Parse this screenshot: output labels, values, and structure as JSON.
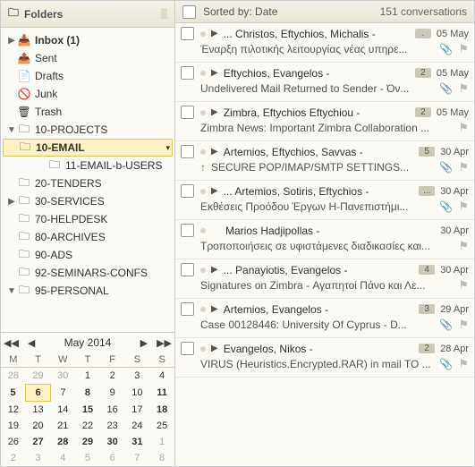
{
  "folders_pane": {
    "title": "Folders",
    "items": [
      {
        "twisty": "▶",
        "depth": 0,
        "icon": "inbox",
        "label": "Inbox (1)",
        "bold": true
      },
      {
        "twisty": "",
        "depth": 0,
        "icon": "sent",
        "label": "Sent"
      },
      {
        "twisty": "",
        "depth": 0,
        "icon": "drafts",
        "label": "Drafts"
      },
      {
        "twisty": "",
        "depth": 0,
        "icon": "junk",
        "label": "Junk"
      },
      {
        "twisty": "",
        "depth": 0,
        "icon": "trash",
        "label": "Trash"
      },
      {
        "twisty": "▼",
        "depth": 0,
        "icon": "folder",
        "label": "10-PROJECTS"
      },
      {
        "twisty": "",
        "depth": 1,
        "icon": "folder",
        "label": "10-EMAIL",
        "selected": true,
        "menu": true
      },
      {
        "twisty": "",
        "depth": 2,
        "icon": "folder",
        "label": "11-EMAIL-b-USERS"
      },
      {
        "twisty": "",
        "depth": 0,
        "icon": "folder",
        "label": "20-TENDERS"
      },
      {
        "twisty": "▶",
        "depth": 0,
        "icon": "folder",
        "label": "30-SERVICES"
      },
      {
        "twisty": "",
        "depth": 0,
        "icon": "folder",
        "label": "70-HELPDESK"
      },
      {
        "twisty": "",
        "depth": 0,
        "icon": "folder",
        "label": "80-ARCHIVES"
      },
      {
        "twisty": "",
        "depth": 0,
        "icon": "folder",
        "label": "90-ADS"
      },
      {
        "twisty": "",
        "depth": 0,
        "icon": "folder",
        "label": "92-SEMINARS-CONFS"
      },
      {
        "twisty": "▼",
        "depth": 0,
        "icon": "folder",
        "label": "95-PERSONAL"
      }
    ]
  },
  "calendar": {
    "title": "May 2014",
    "dow": [
      "M",
      "T",
      "W",
      "T",
      "F",
      "S",
      "S"
    ],
    "weeks": [
      [
        {
          "d": 28,
          "o": true
        },
        {
          "d": 29,
          "o": true
        },
        {
          "d": 30,
          "o": true
        },
        {
          "d": 1
        },
        {
          "d": 2
        },
        {
          "d": 3
        },
        {
          "d": 4
        }
      ],
      [
        {
          "d": 5,
          "b": true
        },
        {
          "d": 6,
          "t": true
        },
        {
          "d": 7
        },
        {
          "d": 8,
          "b": true
        },
        {
          "d": 9
        },
        {
          "d": 10
        },
        {
          "d": 11,
          "b": true
        }
      ],
      [
        {
          "d": 12
        },
        {
          "d": 13
        },
        {
          "d": 14
        },
        {
          "d": 15,
          "b": true
        },
        {
          "d": 16
        },
        {
          "d": 17
        },
        {
          "d": 18,
          "b": true
        }
      ],
      [
        {
          "d": 19
        },
        {
          "d": 20
        },
        {
          "d": 21
        },
        {
          "d": 22
        },
        {
          "d": 23
        },
        {
          "d": 24
        },
        {
          "d": 25
        }
      ],
      [
        {
          "d": 26
        },
        {
          "d": 27,
          "b": true
        },
        {
          "d": 28,
          "b": true
        },
        {
          "d": 29,
          "b": true
        },
        {
          "d": 30,
          "b": true
        },
        {
          "d": 31,
          "b": true
        },
        {
          "d": 1,
          "o": true
        }
      ],
      [
        {
          "d": 2,
          "o": true
        },
        {
          "d": 3,
          "o": true
        },
        {
          "d": 4,
          "o": true
        },
        {
          "d": 5,
          "o": true
        },
        {
          "d": 6,
          "o": true
        },
        {
          "d": 7,
          "o": true
        },
        {
          "d": 8,
          "o": true
        }
      ]
    ]
  },
  "list_header": {
    "sorted_label": "Sorted by: Date",
    "count_label": "151 conversations"
  },
  "conversations": [
    {
      "expand": "▶",
      "ell": true,
      "from": "Christos, Eftychios, Michalis",
      "badge": ".",
      "date": "05 May",
      "subject": "Έναρξη πιλοτικής λειτουργίας νέας υπηρε...",
      "attach": true
    },
    {
      "expand": "▶",
      "from": "Eftychios, Evangelos",
      "badge": "2",
      "date": "05 May",
      "subject": "Undelivered Mail Returned to Sender - Όν...",
      "attach": true
    },
    {
      "expand": "▶",
      "from": "Zimbra, Eftychios Eftychiou",
      "badge": "2",
      "date": "05 May",
      "subject": "Zimbra News: Important Zimbra Collaboration ..."
    },
    {
      "expand": "▶",
      "from": "Artemios, Eftychios, Savvas",
      "badge": "5",
      "date": "30 Apr",
      "prio": true,
      "subject": "SECURE POP/IMAP/SMTP SETTINGS...",
      "attach": true
    },
    {
      "expand": "▶",
      "ell": true,
      "from": "Artemios, Sotiris, Eftychios",
      "badge": "...",
      "date": "30 Apr",
      "subject": "Εκθέσεις Προόδου Έργων Η-Πανεπιστήμι...",
      "attach": true
    },
    {
      "from": "Marios Hadjipollas",
      "date": "30 Apr",
      "subject": "Τροποποιήσεις σε υφιστάμενες διαδικασίες και..."
    },
    {
      "expand": "▶",
      "ell": true,
      "from": "Panayiotis, Evangelos",
      "badge": "4",
      "date": "30 Apr",
      "subject": "Signatures on Zimbra - Αγαπητοί Πάνο και Λε..."
    },
    {
      "expand": "▶",
      "from": "Artemios, Evangelos",
      "badge": "3",
      "date": "29 Apr",
      "subject": "Case 00128446: University Of Cyprus - D...",
      "attach": true
    },
    {
      "expand": "▶",
      "from": "Evangelos, Nikos",
      "badge": "2",
      "date": "28 Apr",
      "subject": "VIRUS (Heuristics.Encrypted.RAR) in mail TO ...",
      "attach": true
    }
  ]
}
